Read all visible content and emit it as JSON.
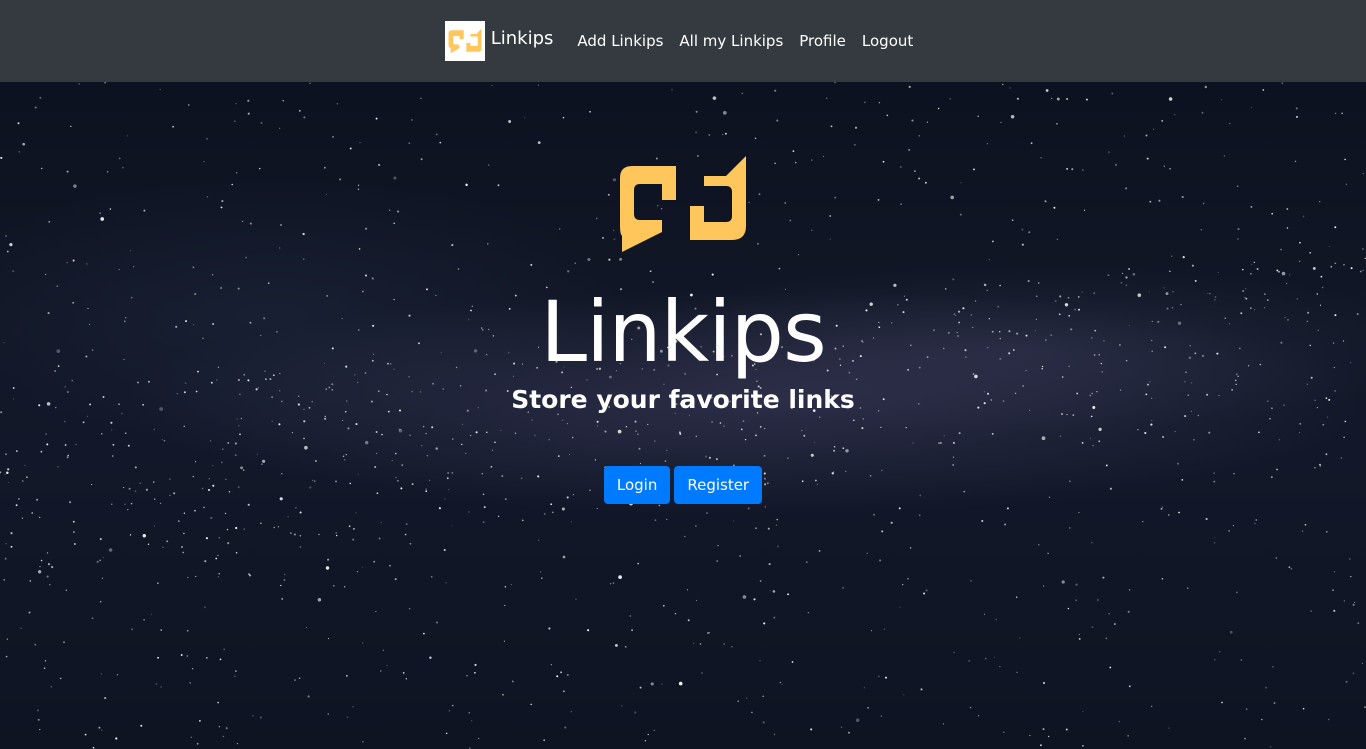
{
  "navbar": {
    "brand": {
      "text": "Linkips",
      "logo_icon": "linkips-logo-icon"
    },
    "links": [
      {
        "label": "Add Linkips"
      },
      {
        "label": "All my Linkips"
      },
      {
        "label": "Profile"
      },
      {
        "label": "Logout"
      }
    ]
  },
  "hero": {
    "logo_icon": "linkips-logo-icon",
    "title": "Linkips",
    "subtitle": "Store your favorite links",
    "buttons": {
      "login_label": "Login",
      "register_label": "Register"
    }
  },
  "colors": {
    "navbar_bg": "#343a40",
    "accent": "#007bff",
    "logo": "#ffc65c"
  }
}
